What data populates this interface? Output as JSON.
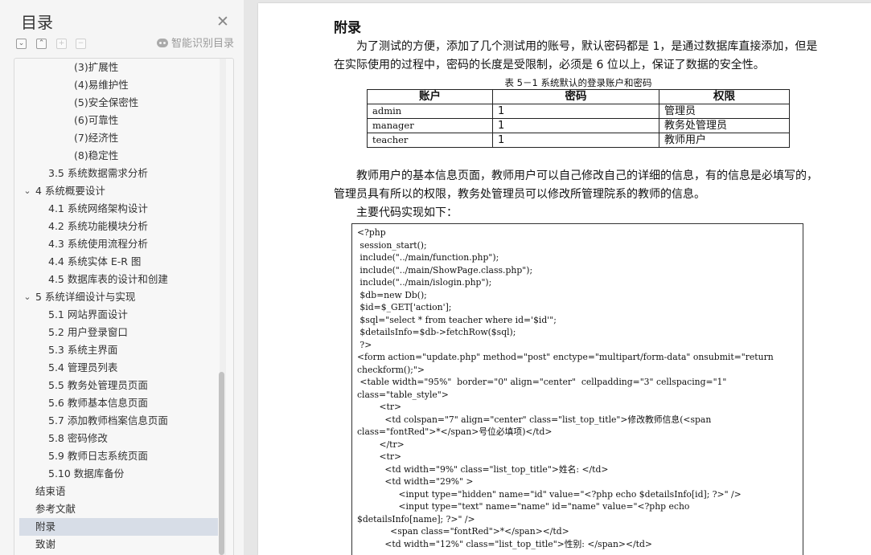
{
  "sidebar": {
    "title": "目录",
    "close_icon": "✕",
    "smart_toc_label": "智能识别目录",
    "tools": [
      "collapse-all",
      "expand-all",
      "add-level",
      "remove-level"
    ],
    "items": [
      {
        "label": "(3)扩展性",
        "level": 3
      },
      {
        "label": "(4)易维护性",
        "level": 3
      },
      {
        "label": "(5)安全保密性",
        "level": 3
      },
      {
        "label": "(6)可靠性",
        "level": 3
      },
      {
        "label": "(7)经济性",
        "level": 3
      },
      {
        "label": "(8)稳定性",
        "level": 3
      },
      {
        "label": "3.5  系统数据需求分析",
        "level": 2
      },
      {
        "label": "4  系统概要设计",
        "level": 1,
        "expanded": true
      },
      {
        "label": "4.1  系统网络架构设计",
        "level": 2
      },
      {
        "label": "4.2  系统功能模块分析",
        "level": 2
      },
      {
        "label": "4.3  系统使用流程分析",
        "level": 2
      },
      {
        "label": "4.4  系统实体 E-R 图",
        "level": 2
      },
      {
        "label": "4.5  数据库表的设计和创建",
        "level": 2
      },
      {
        "label": "5  系统详细设计与实现",
        "level": 1,
        "expanded": true
      },
      {
        "label": "5.1  网站界面设计",
        "level": 2
      },
      {
        "label": "5.2  用户登录窗口",
        "level": 2
      },
      {
        "label": "5.3  系统主界面",
        "level": 2
      },
      {
        "label": "5.4  管理员列表",
        "level": 2
      },
      {
        "label": "5.5  教务处管理员页面",
        "level": 2
      },
      {
        "label": "5.6  教师基本信息页面",
        "level": 2
      },
      {
        "label": "5.7  添加教师档案信息页面",
        "level": 2
      },
      {
        "label": "5.8  密码修改",
        "level": 2
      },
      {
        "label": "5.9  教师日志系统页面",
        "level": 2
      },
      {
        "label": "5.10  数据库备份",
        "level": 2
      },
      {
        "label": "结束语",
        "level": 0
      },
      {
        "label": "参考文献",
        "level": 0
      },
      {
        "label": "附录",
        "level": 0,
        "selected": true
      },
      {
        "label": "致谢",
        "level": 0
      }
    ]
  },
  "document": {
    "heading": "附录",
    "para1_line1": "为了测试的方便，添加了几个测试用的账号，默认密码都是 1，是通过数据库直接添加，但是",
    "para1_line2": "在实际使用的过程中，密码的长度是受限制，必须是 6 位以上，保证了数据的安全性。",
    "table_caption": "表 5－1 系统默认的登录账户和密码",
    "table": {
      "headers": [
        "账户",
        "密码",
        "权限"
      ],
      "rows": [
        [
          "admin",
          "1",
          "管理员"
        ],
        [
          "manager",
          "1",
          "教务处管理员"
        ],
        [
          "teacher",
          "1",
          "教师用户"
        ]
      ]
    },
    "para2_line1": "教师用户的基本信息页面，教师用户可以自己修改自己的详细的信息，有的信息是必填写的，",
    "para2_line2": "管理员具有所以的权限，教务处管理员可以修改所管理院系的教师的信息。",
    "para3": "主要代码实现如下：",
    "code_lines": [
      "<?php",
      " session_start();",
      " include(\"../main/function.php\");",
      " include(\"../main/ShowPage.class.php\");",
      " include(\"../main/islogin.php\");",
      " $db=new Db();",
      " $id=$_GET['action'];",
      " $sql=\"select * from teacher where id='$id'\";",
      " $detailsInfo=$db->fetchRow($sql);",
      " ?>",
      "<form action=\"update.php\" method=\"post\" enctype=\"multipart/form-data\" onsubmit=\"return",
      "checkform();\">",
      " <table width=\"95%\"  border=\"0\" align=\"center\"  cellpadding=\"3\" cellspacing=\"1\"",
      "class=\"table_style\">",
      "        <tr>",
      "          <td colspan=\"7\" align=\"center\" class=\"list_top_title\">修改教师信息(<span",
      "class=\"fontRed\">*</span>号位必填项)</td>",
      "        </tr>",
      "        <tr>",
      "          <td width=\"9%\" class=\"list_top_title\">姓名: </td>",
      "          <td width=\"29%\" >",
      "               <input type=\"hidden\" name=\"id\" value=\"<?php echo $detailsInfo[id]; ?>\" />",
      "               <input type=\"text\" name=\"name\" id=\"name\" value=\"<?php echo",
      "$detailsInfo[name]; ?>\" />",
      "            <span class=\"fontRed\">*</span></td>",
      "          <td width=\"12%\" class=\"list_top_title\">性别: </span></td>"
    ]
  },
  "colors": {
    "sidebar_bg": "#f5f5f5",
    "selected_bg": "#d7dde7",
    "page_bg": "#ffffff",
    "workspace_bg": "#e6e6e6"
  }
}
